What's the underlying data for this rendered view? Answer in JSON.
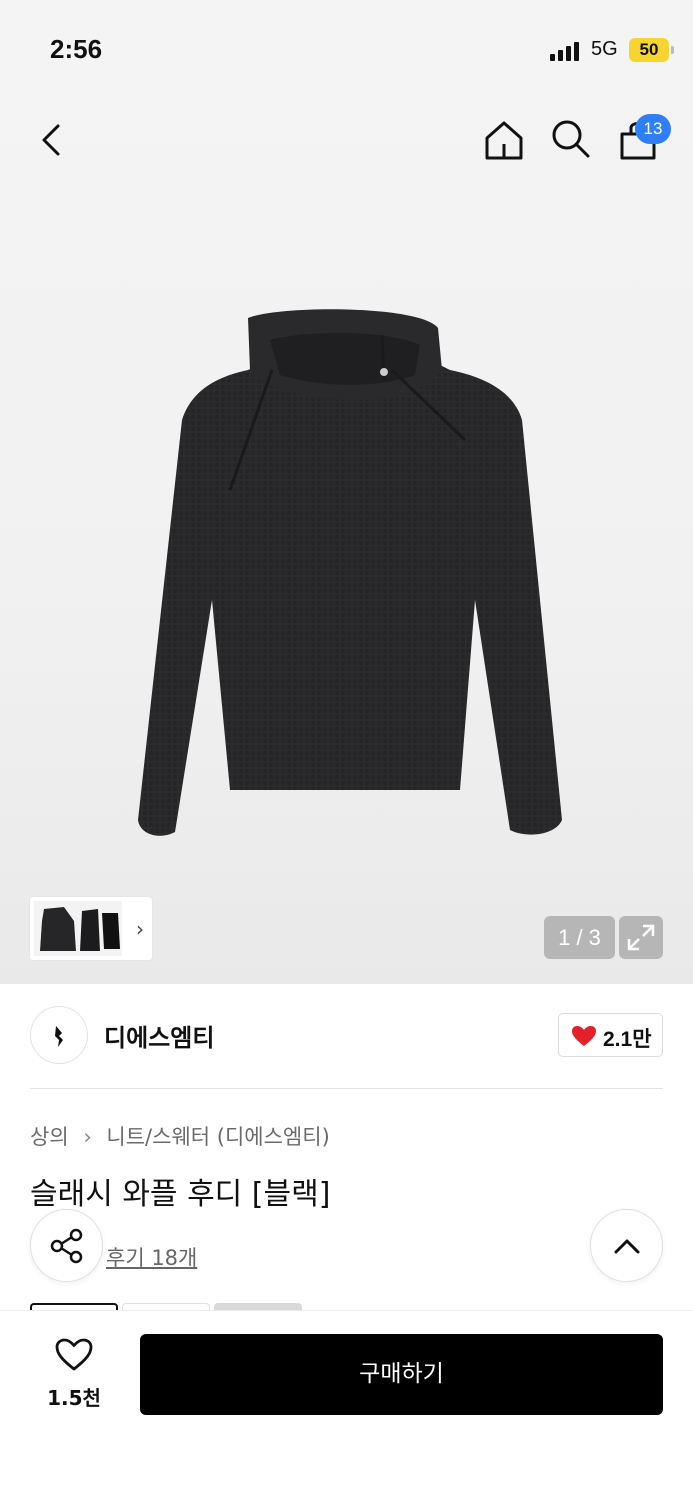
{
  "status_bar": {
    "time": "2:56",
    "network": "5G",
    "battery": "50"
  },
  "header": {
    "cart_count": "13"
  },
  "gallery": {
    "page_counter": "1 / 3",
    "thumbnail_count": 3
  },
  "brand": {
    "name": "디에스엠티",
    "like_count": "2.1만",
    "accent_color": "#e5202a"
  },
  "breadcrumb": {
    "category": "상의",
    "subcategory": "니트/스웨터 (디에스엠티)"
  },
  "product": {
    "title": "슬래시 와플 후디 [블랙]",
    "review_link": "후기 18개"
  },
  "bottom_bar": {
    "wish_count": "1.5천",
    "buy_label": "구매하기"
  },
  "colors": {
    "cart_badge": "#2d7ef7",
    "battery": "#f7d530",
    "buy_button": "#000000"
  },
  "icons": [
    "back-icon",
    "home-icon",
    "search-icon",
    "cart-icon",
    "expand-icon",
    "heart-icon",
    "share-icon",
    "chevron-up-icon",
    "chevron-right-icon"
  ]
}
